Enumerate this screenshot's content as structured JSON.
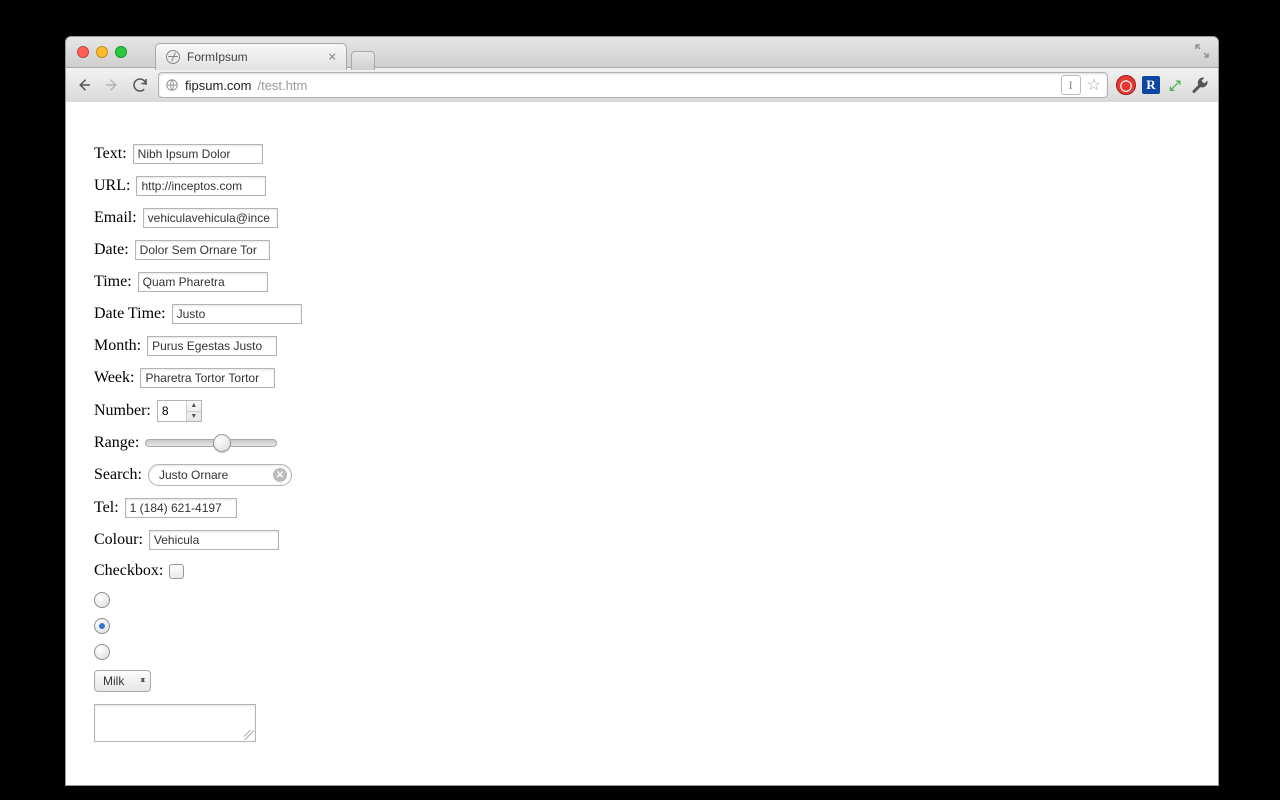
{
  "browser": {
    "tab_title": "FormIpsum",
    "url_host": "fipsum.com",
    "url_path": "/test.htm"
  },
  "fields": {
    "text": {
      "label": "Text:",
      "value": "Nibh Ipsum Dolor"
    },
    "url": {
      "label": "URL:",
      "value": "http://inceptos.com"
    },
    "email": {
      "label": "Email:",
      "value": "vehiculavehicula@ince"
    },
    "date": {
      "label": "Date:",
      "value": "Dolor Sem Ornare Tor"
    },
    "time": {
      "label": "Time:",
      "value": "Quam Pharetra"
    },
    "datetime": {
      "label": "Date Time:",
      "value": "Justo"
    },
    "month": {
      "label": "Month:",
      "value": "Purus Egestas Justo"
    },
    "week": {
      "label": "Week:",
      "value": "Pharetra Tortor Tortor"
    },
    "number": {
      "label": "Number:",
      "value": "8"
    },
    "range": {
      "label": "Range:",
      "percent": 58
    },
    "search": {
      "label": "Search:",
      "value": "Justo Ornare"
    },
    "tel": {
      "label": "Tel:",
      "value": "1 (184) 621-4197"
    },
    "colour": {
      "label": "Colour:",
      "value": "Vehicula"
    },
    "checkbox": {
      "label": "Checkbox:",
      "checked": false
    },
    "radio": {
      "selected_index": 1,
      "count": 3
    },
    "select": {
      "value": "Milk"
    },
    "textarea": {
      "value": ""
    }
  }
}
